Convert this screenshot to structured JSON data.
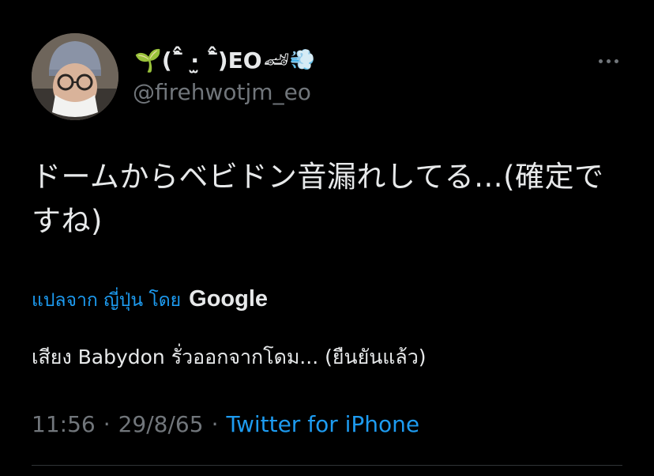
{
  "author": {
    "display_name_prefix": "🌱(ˆ᷅̂ ·̫ ˆ᷅̂)EO",
    "display_name_suffix": "🏎💨",
    "handle": "@firehwotjm_eo"
  },
  "tweet": {
    "text": "ドームからベビドン音漏れしてる...(確定ですね)"
  },
  "translation": {
    "link_label": "แปลจาก ญี่ปุ่น โดย",
    "provider": "Google",
    "text": "เสียง Babydon รั่วออกจากโดม... (ยืนยันแล้ว)"
  },
  "meta": {
    "time": "11:56",
    "date": "29/8/65",
    "separator": "·",
    "source": "Twitter for iPhone"
  },
  "icons": {
    "more": "more-horizontal-icon",
    "avatar": "avatar"
  },
  "colors": {
    "background": "#000000",
    "text": "#e7e9ea",
    "secondary": "#71767b",
    "link": "#1d9bf0",
    "divider": "#2f3336"
  }
}
